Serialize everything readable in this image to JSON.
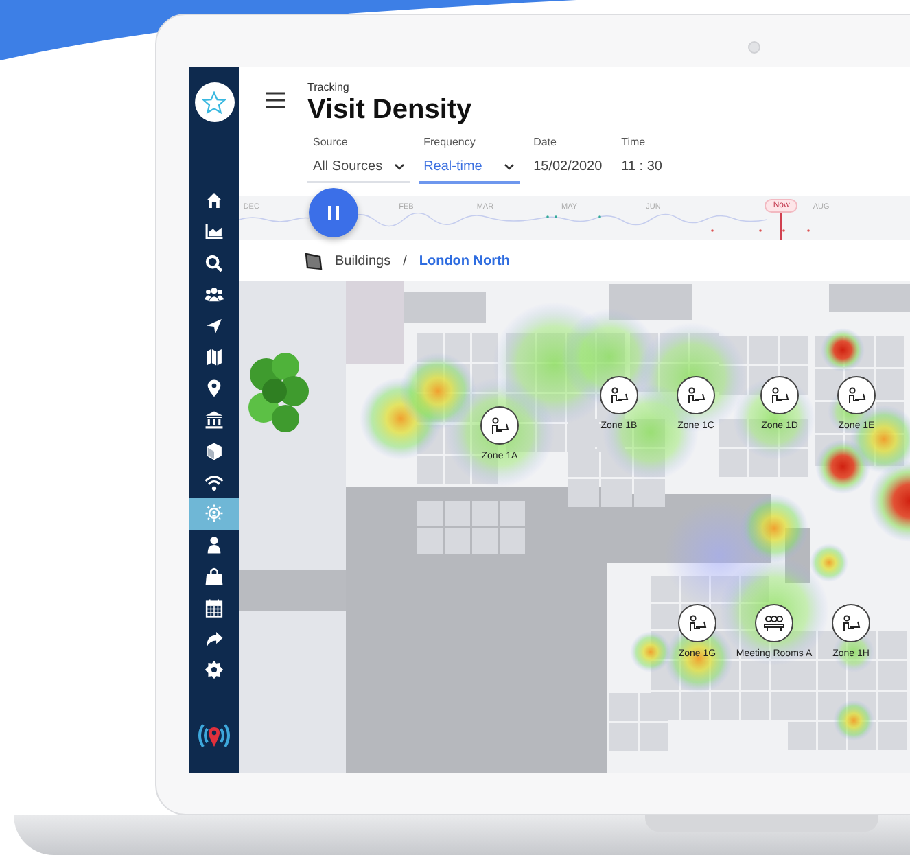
{
  "sidebar": {
    "items": [
      {
        "selected": false
      },
      {
        "selected": false
      },
      {
        "selected": false
      },
      {
        "selected": false
      },
      {
        "selected": false
      },
      {
        "selected": false
      },
      {
        "selected": false
      },
      {
        "selected": false
      },
      {
        "selected": false
      },
      {
        "selected": false
      },
      {
        "selected": true
      },
      {
        "selected": false
      },
      {
        "selected": false
      },
      {
        "selected": false
      },
      {
        "selected": false
      },
      {
        "selected": false
      }
    ]
  },
  "header": {
    "section": "Tracking",
    "title": "Visit Density"
  },
  "filters": [
    {
      "label": "Source",
      "value": "All Sources",
      "kind": "dropdown",
      "selected": false
    },
    {
      "label": "Frequency",
      "value": "Real-time",
      "kind": "dropdown",
      "selected": true
    },
    {
      "label": "Date",
      "value": "15/02/2020",
      "kind": "text",
      "selected": false
    },
    {
      "label": "Time",
      "value": "11 : 30",
      "kind": "text",
      "selected": false
    }
  ],
  "timeline": {
    "labels": [
      {
        "text": "DEC",
        "kind": "month"
      },
      {
        "text": "FEB",
        "kind": "month"
      },
      {
        "text": "MAR",
        "kind": "month"
      },
      {
        "text": "MAY",
        "kind": "month"
      },
      {
        "text": "JUN",
        "kind": "month"
      },
      {
        "text": "Now",
        "kind": "now"
      },
      {
        "text": "AUG",
        "kind": "month"
      }
    ]
  },
  "breadcrumb": {
    "items": [
      "Buildings",
      "London North"
    ],
    "separator": "/"
  },
  "zones": [
    {
      "label": "Zone 1A",
      "kind": "desk"
    },
    {
      "label": "Zone 1B",
      "kind": "desk"
    },
    {
      "label": "Zone 1C",
      "kind": "desk"
    },
    {
      "label": "Zone 1D",
      "kind": "desk"
    },
    {
      "label": "Zone 1E",
      "kind": "desk"
    },
    {
      "label": "Zone 1G",
      "kind": "desk"
    },
    {
      "label": "Meeting Rooms A",
      "kind": "meeting"
    },
    {
      "label": "Zone 1H",
      "kind": "desk"
    }
  ]
}
